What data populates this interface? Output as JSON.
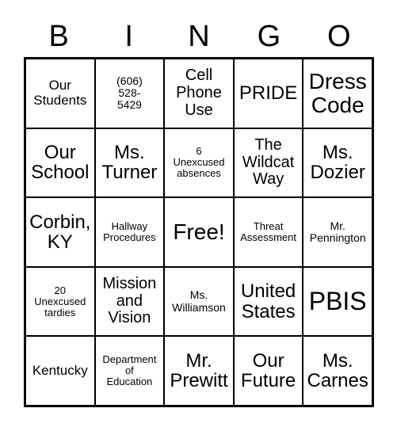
{
  "header": {
    "letters": [
      "B",
      "I",
      "N",
      "G",
      "O"
    ]
  },
  "cells": [
    {
      "text": "Our\nStudents"
    },
    {
      "text": "(606)\n528-\n5429"
    },
    {
      "text": "Cell\nPhone\nUse"
    },
    {
      "text": "PRIDE"
    },
    {
      "text": "Dress\nCode"
    },
    {
      "text": "Our\nSchool"
    },
    {
      "text": "Ms.\nTurner"
    },
    {
      "text": "6\nUnexcused\nabsences"
    },
    {
      "text": "The\nWildcat\nWay"
    },
    {
      "text": "Ms.\nDozier"
    },
    {
      "text": "Corbin,\nKY"
    },
    {
      "text": "Hallway\nProcedures"
    },
    {
      "text": "Free!"
    },
    {
      "text": "Threat\nAssessment"
    },
    {
      "text": "Mr.\nPennington"
    },
    {
      "text": "20\nUnexcused\ntardies"
    },
    {
      "text": "Mission\nand\nVision"
    },
    {
      "text": "Ms.\nWilliamson"
    },
    {
      "text": "United\nStates"
    },
    {
      "text": "PBIS"
    },
    {
      "text": "Kentucky"
    },
    {
      "text": "Department\nof\nEducation"
    },
    {
      "text": "Mr.\nPrewitt"
    },
    {
      "text": "Our\nFuture"
    },
    {
      "text": "Ms.\nCarnes"
    }
  ]
}
